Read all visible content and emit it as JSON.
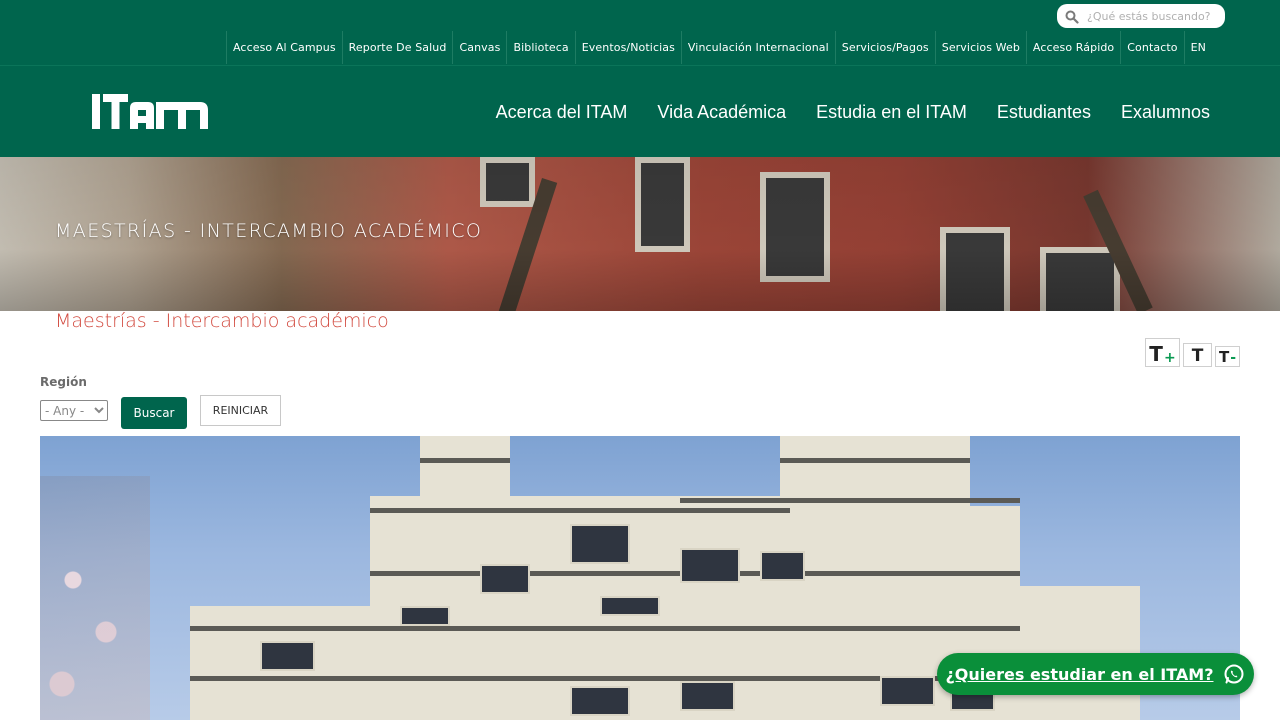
{
  "search": {
    "placeholder": "¿Qué estás buscando?"
  },
  "utility_links": [
    {
      "label": "Acceso Al Campus"
    },
    {
      "label": "Reporte De Salud"
    },
    {
      "label": "Canvas"
    },
    {
      "label": "Biblioteca"
    },
    {
      "label": "Eventos/Noticias"
    },
    {
      "label": "Vinculación Internacional"
    },
    {
      "label": "Servicios/Pagos"
    },
    {
      "label": "Servicios Web"
    },
    {
      "label": "Acceso Rápido"
    },
    {
      "label": "Contacto"
    },
    {
      "label": "EN"
    }
  ],
  "logo": {
    "text": "ITAM"
  },
  "main_nav": [
    {
      "label": "Acerca del ITAM"
    },
    {
      "label": "Vida Académica"
    },
    {
      "label": "Estudia en el ITAM"
    },
    {
      "label": "Estudiantes"
    },
    {
      "label": "Exalumnos"
    }
  ],
  "hero": {
    "title": "MAESTRÍAS - INTERCAMBIO ACADÉMICO"
  },
  "page": {
    "subtitle": "Maestrías - Intercambio académico"
  },
  "font_tools": {
    "increase": "T",
    "increase_sign": "+",
    "normal": "T",
    "decrease": "T",
    "decrease_sign": "-"
  },
  "filter": {
    "label": "Región",
    "selected": "- Any -",
    "submit_label": "Buscar",
    "reset_label": "REINICIAR"
  },
  "cta": {
    "label": "¿Quieres estudiar en el ITAM?"
  },
  "colors": {
    "brand_green": "#00654d",
    "accent_red": "#d24a3f",
    "cta_green": "#0a8f3a"
  },
  "icons": {
    "search": "search-icon",
    "whatsapp": "whatsapp-icon"
  }
}
